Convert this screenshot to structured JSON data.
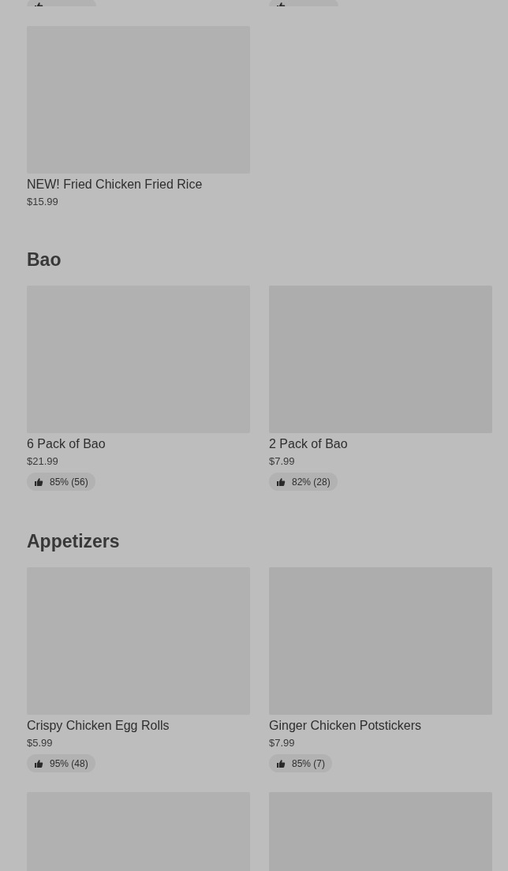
{
  "sections": [
    {
      "items": [
        {
          "kind": "cut_badge"
        },
        {
          "kind": "cut_badge"
        },
        {
          "kind": "dish",
          "name": "NEW! Fried Chicken Fried Rice",
          "price": "$15.99"
        }
      ]
    },
    {
      "title": "Bao",
      "items": [
        {
          "kind": "dish",
          "name": "6 Pack of Bao",
          "price": "$21.99",
          "rating": "85% (56)"
        },
        {
          "kind": "dish",
          "name": "2 Pack of Bao",
          "price": "$7.99",
          "rating": "82% (28)"
        }
      ]
    },
    {
      "title": "Appetizers",
      "items": [
        {
          "kind": "dish",
          "name": "Crispy Chicken Egg Rolls",
          "price": "$5.99",
          "rating": "95% (48)"
        },
        {
          "kind": "dish",
          "name": "Ginger Chicken Potstickers",
          "price": "$7.99",
          "rating": "85% (7)"
        },
        {
          "kind": "image_only"
        },
        {
          "kind": "image_only"
        }
      ]
    }
  ]
}
